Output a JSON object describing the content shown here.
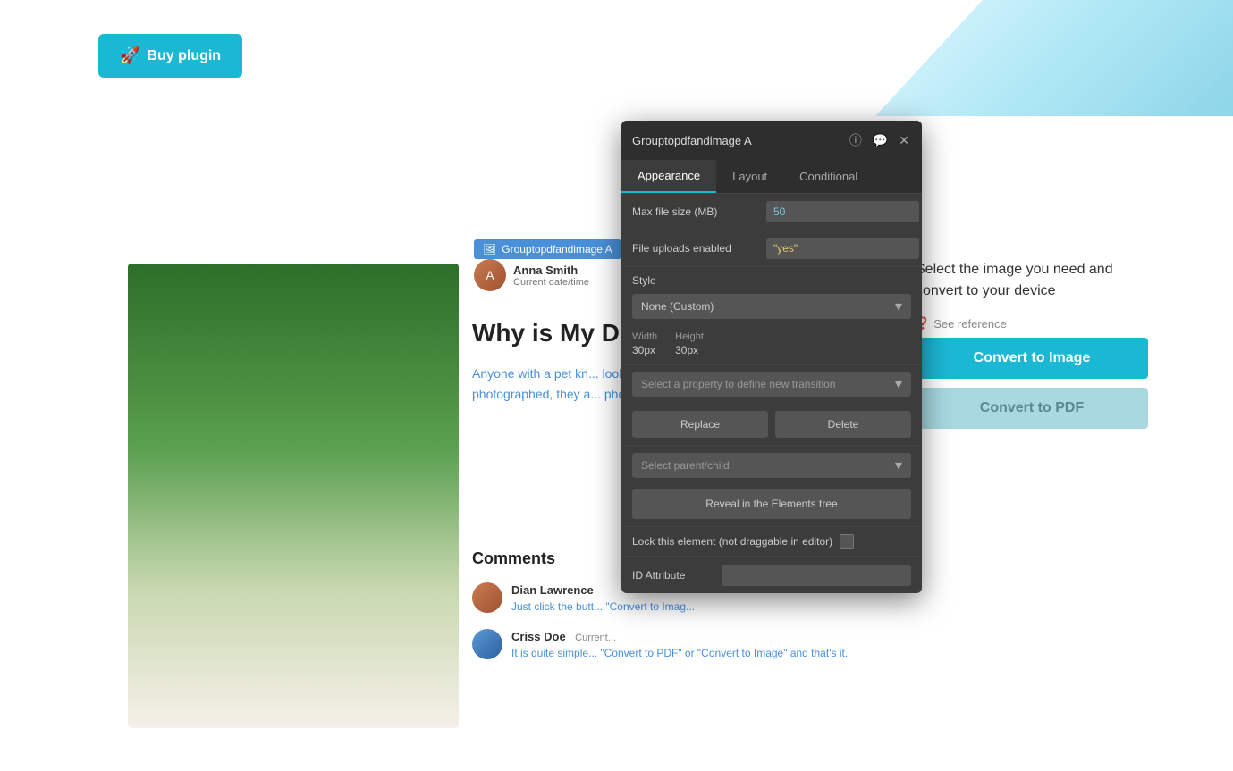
{
  "page": {
    "background_color": "#ffffff"
  },
  "buy_button": {
    "label": "Buy plugin",
    "icon": "🚀"
  },
  "blog": {
    "bubble_label": "Grouptopdfandimage A",
    "author_name": "Anna Smith",
    "author_date": "Current date/time",
    "title": "Why is My D... Staring at M...",
    "excerpt": "Anyone with a pet kn... look in pictures. Whe... playing, or stealing yo... photographed, they a... photogenic creatures...",
    "comments_title": "Comments",
    "comments": [
      {
        "author": "Dian Lawrence",
        "date": "",
        "text": "Just click the butt... \"Convert to Imag...",
        "avatar_color": "brown"
      },
      {
        "author": "Criss Doe",
        "date": "Current...",
        "text": "It is quite simple... \"Convert to PDF\" or \"Convert to Image\" and that's it.",
        "avatar_color": "blue"
      }
    ]
  },
  "right_side": {
    "text": "Select the image you need and convert to your device",
    "see_reference_label": "See reference",
    "convert_image_label": "Convert to Image",
    "convert_pdf_label": "Convert to PDF"
  },
  "panel": {
    "title": "Grouptopdfandimage A",
    "tabs": [
      {
        "label": "Appearance",
        "active": true
      },
      {
        "label": "Layout",
        "active": false
      },
      {
        "label": "Conditional",
        "active": false
      }
    ],
    "fields": {
      "max_file_size_label": "Max file size (MB)",
      "max_file_size_value": "50",
      "file_uploads_label": "File uploads enabled",
      "file_uploads_value": "\"yes\"",
      "style_label": "Style",
      "style_value": "None (Custom)",
      "width_label": "Width",
      "width_value": "30px",
      "height_label": "Height",
      "height_value": "30px",
      "transition_placeholder": "Select a property to define new transition",
      "replace_label": "Replace",
      "delete_label": "Delete",
      "parent_child_placeholder": "Select parent/child",
      "reveal_label": "Reveal in the Elements tree",
      "lock_label": "Lock this element (not draggable in editor)",
      "id_label": "ID Attribute"
    },
    "icons": {
      "info": "ℹ",
      "comment": "💬",
      "close": "✕"
    }
  }
}
